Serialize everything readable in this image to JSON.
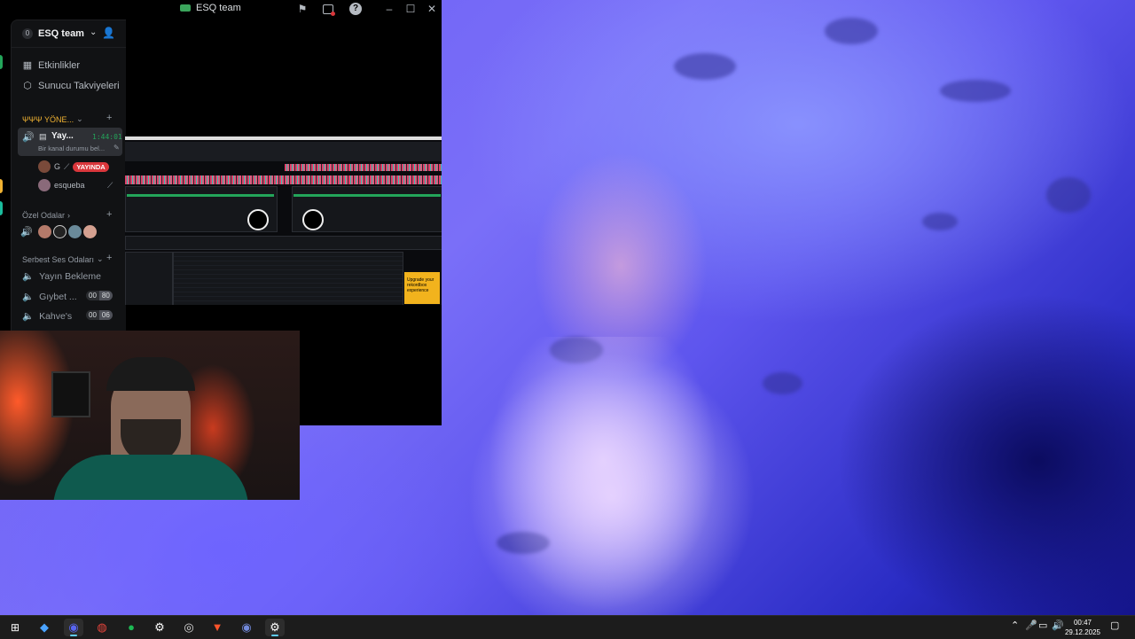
{
  "window": {
    "title": "ESQ team"
  },
  "server": {
    "badge": "0",
    "name": "ESQ team"
  },
  "nav": {
    "events": "Etkinlikler",
    "boosts": "Sunucu Takviyeleri"
  },
  "categories": {
    "admin": "ΨΨΨ YÖNE...",
    "private": "Özel Odalar",
    "free": "Serbest Ses Odaları"
  },
  "active_channel": {
    "name": "Yay...",
    "timer": "1:44:01",
    "status": "Bir kanal durumu bel..."
  },
  "users": [
    {
      "name": "G",
      "badge": "YAYINDA"
    },
    {
      "name": "esqueba"
    }
  ],
  "channels": [
    {
      "name": "Yayın Bekleme"
    },
    {
      "name": "Gıybet ...",
      "count_a": "00",
      "count_b": "80"
    },
    {
      "name": "Kahve's",
      "count_a": "00",
      "count_b": "06"
    }
  ],
  "stream_ad": "Upgrade your rekordbox experience",
  "taskbar": {
    "apps": [
      "explorer-icon",
      "discord-icon",
      "chrome-icon",
      "spotify-icon",
      "steam-icon",
      "obs-icon",
      "brave-icon",
      "discord-ptb-icon",
      "steam-icon"
    ],
    "time": "00:47",
    "date": "29.12.2025"
  },
  "colors": {
    "discord_bg": "#111214",
    "accent_green": "#23a55a",
    "live_red": "#da373c"
  }
}
